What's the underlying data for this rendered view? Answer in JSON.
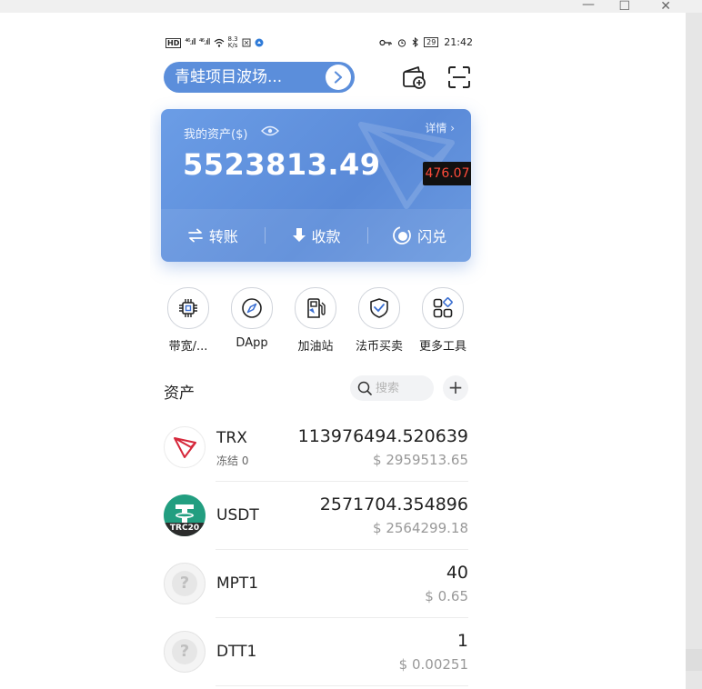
{
  "status_bar": {
    "hd": "HD",
    "signal1": "⁴⁶.ıll",
    "signal2": "⁴⁶.ıll",
    "speed_value": "8.3",
    "speed_unit": "K/s",
    "battery": "29",
    "time": "21:42"
  },
  "wallet": {
    "name": "青蛙项目波场..."
  },
  "card": {
    "label": "我的资产($)",
    "details": "详情 ›",
    "balance": "5523813.49",
    "price_badge": "476.07",
    "actions": [
      {
        "label": "转账",
        "icon": "transfer-icon"
      },
      {
        "label": "收款",
        "icon": "receive-icon"
      },
      {
        "label": "闪兑",
        "icon": "swap-icon"
      }
    ]
  },
  "tools": [
    {
      "label": "带宽/...",
      "icon": "chip-icon"
    },
    {
      "label": "DApp",
      "icon": "compass-icon"
    },
    {
      "label": "加油站",
      "icon": "gas-station-icon"
    },
    {
      "label": "法币买卖",
      "icon": "shield-icon"
    },
    {
      "label": "更多工具",
      "icon": "grid-icon"
    }
  ],
  "assets": {
    "title": "资产",
    "search_placeholder": "搜索",
    "add_label": "+"
  },
  "tokens": [
    {
      "symbol": "TRX",
      "sub": "冻结 0",
      "amount": "113976494.520639",
      "value": "$ 2959513.65",
      "icon": "trx-icon"
    },
    {
      "symbol": "USDT",
      "sub": "",
      "amount": "2571704.354896",
      "value": "$ 2564299.18",
      "icon": "usdt-icon",
      "icon_label": "TRC20"
    },
    {
      "symbol": "MPT1",
      "sub": "",
      "amount": "40",
      "value": "$ 0.65",
      "icon": "generic-token-icon"
    },
    {
      "symbol": "DTT1",
      "sub": "",
      "amount": "1",
      "value": "$ 0.00251",
      "icon": "generic-token-icon"
    }
  ],
  "colors": {
    "accent": "#5b8edb",
    "badge_text": "#ff4b3a",
    "trx_red": "#d6283b",
    "usdt_green": "#229e80"
  }
}
